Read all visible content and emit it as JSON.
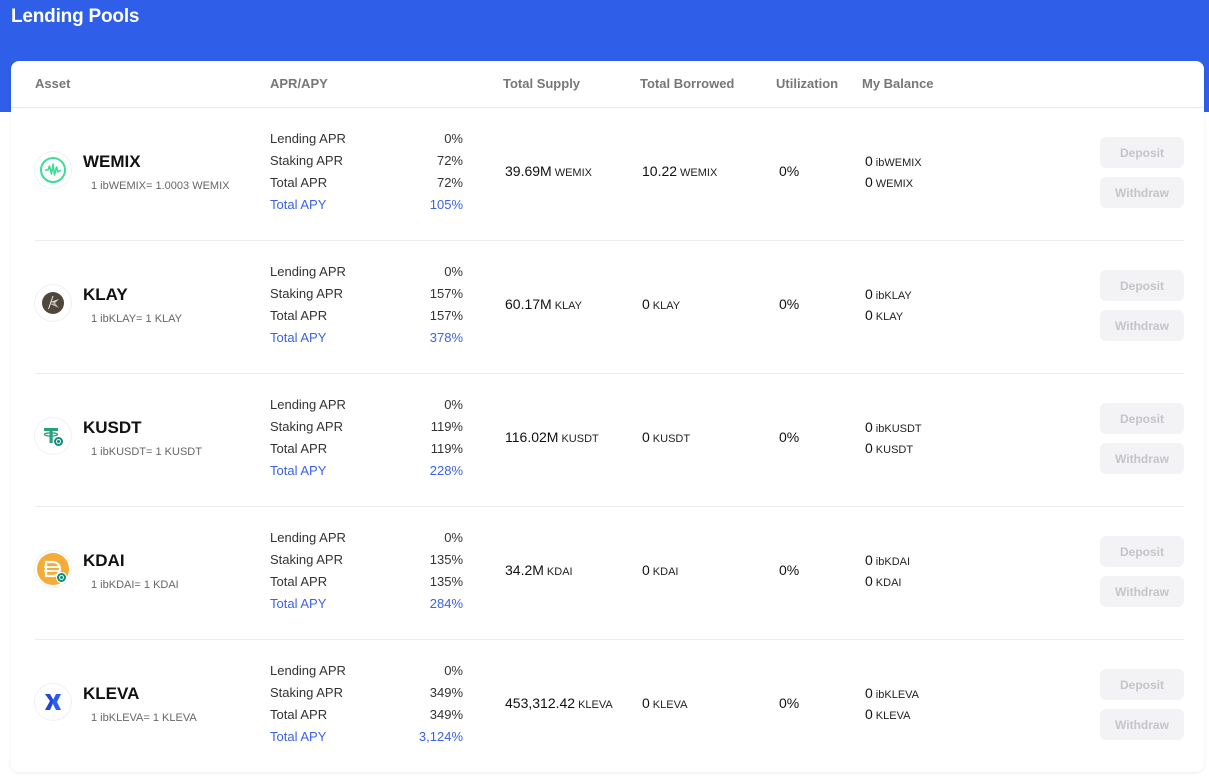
{
  "header": {
    "title": "Lending Pools"
  },
  "columns": {
    "asset": "Asset",
    "apr_apy": "APR/APY",
    "total_supply": "Total Supply",
    "total_borrowed": "Total Borrowed",
    "utilization": "Utilization",
    "my_balance": "My Balance"
  },
  "labels": {
    "lending_apr": "Lending APR",
    "staking_apr": "Staking APR",
    "total_apr": "Total APR",
    "total_apy": "Total APY",
    "deposit": "Deposit",
    "withdraw": "Withdraw"
  },
  "colors": {
    "banner": "#2f5ee8",
    "apy": "#3a62e6",
    "disabled_button_bg": "#f3f3f5"
  },
  "pools": [
    {
      "name": "WEMIX",
      "icon": "wemix-logo-icon",
      "rate": "1 ibWEMIX= 1.0003 WEMIX",
      "lending_apr": "0%",
      "staking_apr": "72%",
      "total_apr": "72%",
      "total_apy": "105%",
      "supply": "39.69M",
      "supply_unit": "WEMIX",
      "borrowed": "10.22",
      "borrowed_unit": "WEMIX",
      "utilization": "0%",
      "bal_ib": "0",
      "bal_ib_unit": "ibWEMIX",
      "bal": "0",
      "bal_unit": "WEMIX"
    },
    {
      "name": "KLAY",
      "icon": "klay-logo-icon",
      "rate": "1 ibKLAY= 1 KLAY",
      "lending_apr": "0%",
      "staking_apr": "157%",
      "total_apr": "157%",
      "total_apy": "378%",
      "supply": "60.17M",
      "supply_unit": "KLAY",
      "borrowed": "0",
      "borrowed_unit": "KLAY",
      "utilization": "0%",
      "bal_ib": "0",
      "bal_ib_unit": "ibKLAY",
      "bal": "0",
      "bal_unit": "KLAY"
    },
    {
      "name": "KUSDT",
      "icon": "kusdt-logo-icon",
      "rate": "1 ibKUSDT= 1 KUSDT",
      "lending_apr": "0%",
      "staking_apr": "119%",
      "total_apr": "119%",
      "total_apy": "228%",
      "supply": "116.02M",
      "supply_unit": "KUSDT",
      "borrowed": "0",
      "borrowed_unit": "KUSDT",
      "utilization": "0%",
      "bal_ib": "0",
      "bal_ib_unit": "ibKUSDT",
      "bal": "0",
      "bal_unit": "KUSDT"
    },
    {
      "name": "KDAI",
      "icon": "kdai-logo-icon",
      "rate": "1 ibKDAI= 1 KDAI",
      "lending_apr": "0%",
      "staking_apr": "135%",
      "total_apr": "135%",
      "total_apy": "284%",
      "supply": "34.2M",
      "supply_unit": "KDAI",
      "borrowed": "0",
      "borrowed_unit": "KDAI",
      "utilization": "0%",
      "bal_ib": "0",
      "bal_ib_unit": "ibKDAI",
      "bal": "0",
      "bal_unit": "KDAI"
    },
    {
      "name": "KLEVA",
      "icon": "kleva-logo-icon",
      "rate": "1 ibKLEVA= 1 KLEVA",
      "lending_apr": "0%",
      "staking_apr": "349%",
      "total_apr": "349%",
      "total_apy": "3,124%",
      "supply": "453,312.42",
      "supply_unit": "KLEVA",
      "borrowed": "0",
      "borrowed_unit": "KLEVA",
      "utilization": "0%",
      "bal_ib": "0",
      "bal_ib_unit": "ibKLEVA",
      "bal": "0",
      "bal_unit": "KLEVA"
    }
  ]
}
